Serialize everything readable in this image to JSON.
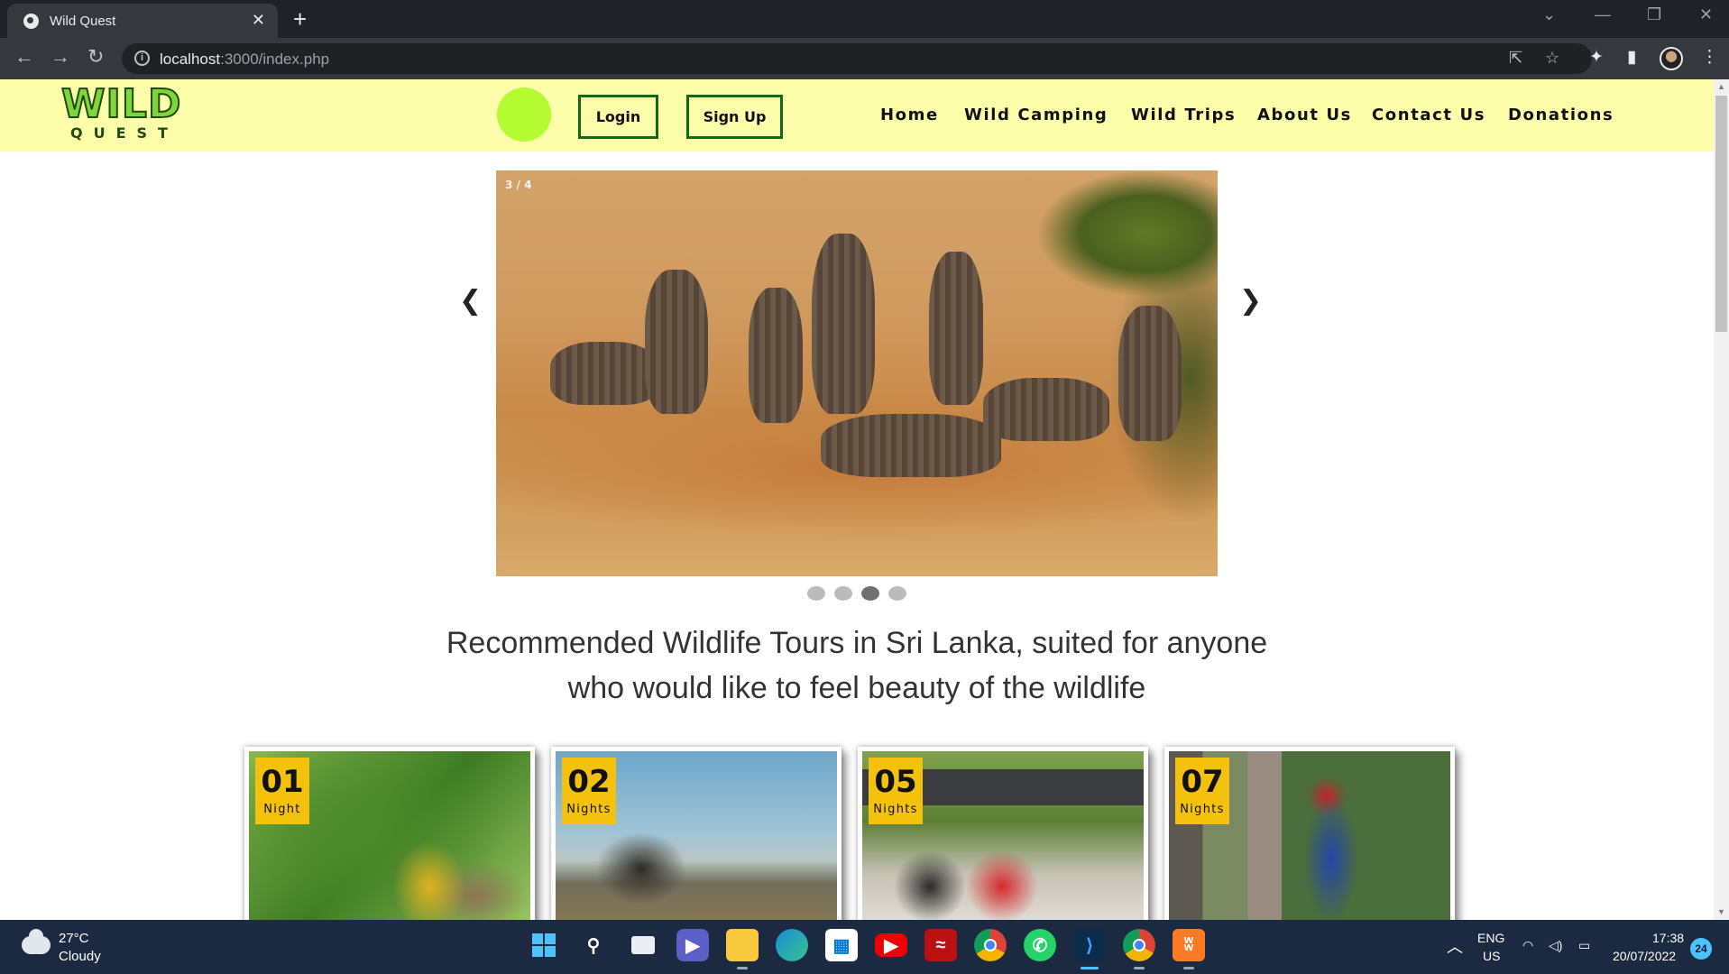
{
  "browser": {
    "tab_title": "Wild Quest",
    "tab_close": "✕",
    "new_tab": "+",
    "url_host": "localhost",
    "url_path": ":3000/index.php",
    "info_glyph": "i",
    "icons": [
      "back-arrow-icon",
      "forward-arrow-icon",
      "reload-icon",
      "share-icon",
      "bookmark-star-icon",
      "extensions-icon",
      "side-panel-icon",
      "profile-avatar-icon",
      "kebab-menu-icon"
    ]
  },
  "header": {
    "logo_top": "WILD",
    "logo_bottom": "QUEST",
    "login_label": "Login",
    "signup_label": "Sign Up",
    "nav": [
      "Home",
      "Wild Camping",
      "Wild Trips",
      "About Us",
      "Contact Us",
      "Donations"
    ],
    "colors": {
      "header_bg": "#fdfea9",
      "circle": "#b5fb32",
      "button_border": "#0b6b16"
    }
  },
  "carousel": {
    "counter": "3 / 4",
    "prev": "❮",
    "next": "❯",
    "total_slides": 4,
    "active_index": 2
  },
  "heading": {
    "line1": "Recommended Wildlife Tours in Sri Lanka, suited for anyone",
    "line2": "who would like to feel beauty of the wildlife"
  },
  "tours": [
    {
      "num": "01",
      "unit": "Night"
    },
    {
      "num": "02",
      "unit": "Nights"
    },
    {
      "num": "05",
      "unit": "Nights"
    },
    {
      "num": "07",
      "unit": "Nights"
    }
  ],
  "taskbar": {
    "temperature": "27°C",
    "condition": "Cloudy",
    "lang_top": "ENG",
    "lang_bottom": "US",
    "time": "17:38",
    "date": "20/07/2022",
    "notifications": "24",
    "apps": [
      "windows-start-icon",
      "search-icon",
      "task-view-icon",
      "teams-chat-icon",
      "file-explorer-icon",
      "edge-icon",
      "store-icon",
      "youtube-icon",
      "app-icon",
      "chrome-icon",
      "whatsapp-icon",
      "vscode-icon",
      "chrome-profile-icon",
      "xampp-icon"
    ]
  }
}
